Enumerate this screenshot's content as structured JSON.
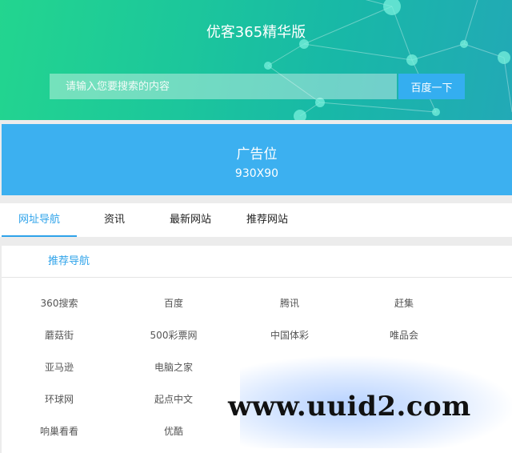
{
  "header": {
    "site_title": "优客365精华版",
    "search_placeholder": "请输入您要搜索的内容",
    "search_button": "百度一下"
  },
  "ad": {
    "line1": "广告位",
    "line2": "930X90"
  },
  "tabs": [
    {
      "label": "网址导航",
      "active": true
    },
    {
      "label": "资讯",
      "active": false
    },
    {
      "label": "最新网站",
      "active": false
    },
    {
      "label": "推荐网站",
      "active": false
    }
  ],
  "nav": {
    "title": "推荐导航",
    "links": [
      "360搜索",
      "百度",
      "腾讯",
      "赶集",
      "蘑菇街",
      "500彩票网",
      "中国体彩",
      "唯品会",
      "亚马逊",
      "电脑之家",
      "",
      "",
      "环球网",
      "起点中文",
      "",
      "",
      "响巢看看",
      "优酷",
      "",
      ""
    ]
  },
  "watermark": "www.uuid2.com",
  "colors": {
    "accent": "#2fa3ea",
    "ad_bg": "#3cb0f0",
    "hero_start": "#23d58f",
    "hero_end": "#22a9b6"
  }
}
